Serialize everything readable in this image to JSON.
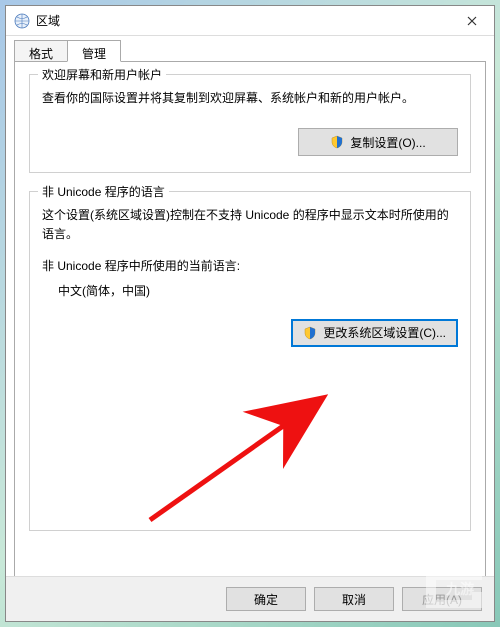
{
  "window": {
    "title": "区域",
    "close_tooltip": "关闭"
  },
  "tabs": {
    "format": "格式",
    "admin": "管理"
  },
  "group1": {
    "title": "欢迎屏幕和新用户帐户",
    "desc": "查看你的国际设置并将其复制到欢迎屏幕、系统帐户和新的用户帐户。",
    "button": "复制设置(O)..."
  },
  "group2": {
    "title": "非 Unicode 程序的语言",
    "desc": "这个设置(系统区域设置)控制在不支持 Unicode 的程序中显示文本时所使用的语言。",
    "current_label": "非 Unicode 程序中所使用的当前语言:",
    "current_value": "中文(简体，中国)",
    "button": "更改系统区域设置(C)..."
  },
  "footer": {
    "ok": "确定",
    "cancel": "取消",
    "apply": "应用(A)"
  },
  "watermark": "九游"
}
